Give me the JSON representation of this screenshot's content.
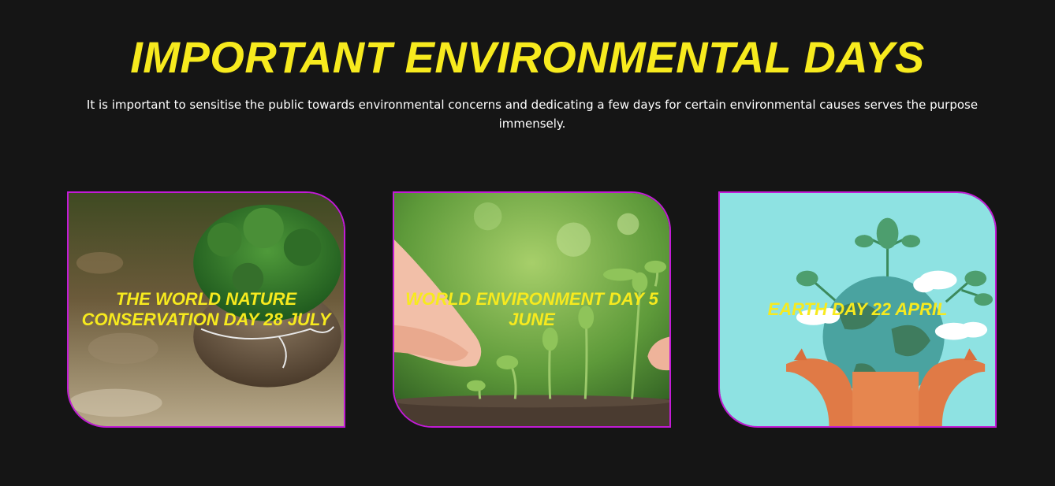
{
  "header": {
    "title": "IMPORTANT ENVIRONMENTAL DAYS",
    "intro": "It is important to sensitise the public towards environmental concerns and dedicating a few days for certain environmental causes serves the purpose immensely."
  },
  "cards": [
    {
      "label": "THE WORLD NATURE CONSERVATION DAY 28 JULY",
      "image": "tree-in-glass-sphere"
    },
    {
      "label": "WORLD ENVIRONMENT DAY 5 JUNE",
      "image": "hand-watering-seedlings"
    },
    {
      "label": "EARTH DAY 22 APRIL",
      "image": "hands-holding-earth-with-plant"
    }
  ],
  "colors": {
    "background": "#151515",
    "accent_yellow": "#f7ea1e",
    "card_border": "#c21bd6",
    "text": "#ffffff"
  }
}
